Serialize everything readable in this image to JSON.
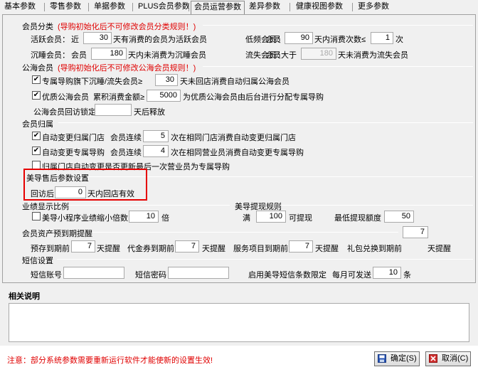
{
  "tabs": [
    "基本参数",
    "零售参数",
    "单据参数",
    "PLUS会员参数",
    "会员运营参数",
    "差异参数",
    "健康视图参数",
    "更多参数"
  ],
  "active_tab": "会员运营参数",
  "member_class": {
    "title": "会员分类",
    "warning": "(导购初始化后不可修改会员分类规则！)",
    "active_label": "活跃会员：",
    "active_pre": "近",
    "active_value": "30",
    "active_suffix": "天有消费的会员为活跃会员",
    "low_label": "低频会员：",
    "low_pre": "会员",
    "low_value": "90",
    "low_mid": "天内消费次数≤",
    "low_count": "1",
    "low_suffix": "次",
    "sleep_label": "沉睡会员：",
    "sleep_pre": "会员",
    "sleep_value": "180",
    "sleep_suffix": "天内未消费为沉睡会员",
    "lost_label": "流失会员：",
    "lost_pre": "会员大于",
    "lost_value": "180",
    "lost_suffix": "天未消费为流失会员"
  },
  "public_member": {
    "title": "公海会员",
    "warning": "(导购初始化后不可修改公海会员规则！)",
    "opt1_label": "专属导购旗下沉睡/流失会员≥",
    "opt1_value": "30",
    "opt1_suffix": "天未回店消费自动归属公海会员",
    "opt2_label": "优质公海会员",
    "opt2_mid": "累积消费金额≥",
    "opt2_value": "5000",
    "opt2_suffix": "为优质公海会员由后台进行分配专属导购",
    "lock_label": "公海会员回访锁定",
    "lock_value": "",
    "lock_suffix": "天后释放"
  },
  "member_belong": {
    "title": "会员归属",
    "opt1_label": "自动变更归属门店",
    "opt1_mid": "会员连续",
    "opt1_value": "5",
    "opt1_suffix": "次在相同门店消费自动变更归属门店",
    "opt2_label": "自动变更专属导购",
    "opt2_mid": "会员连续",
    "opt2_value": "4",
    "opt2_suffix": "次在相同营业员消费自动变更专属导购",
    "opt3_label": "归属门店自动变更是否更新最后一次营业员为专属导购"
  },
  "after_sale": {
    "title": "美导售后参数设置",
    "pre": "回访后",
    "value": "0",
    "suffix": "天内回店有效"
  },
  "performance": {
    "title": "业绩显示比例",
    "opt_label": "美导小程序业绩缩小倍数",
    "opt_value": "10",
    "opt_suffix": "倍"
  },
  "withdraw": {
    "title": "美导提现规则",
    "full_label": "满",
    "full_value": "100",
    "full_suffix": "可提现",
    "min_label": "最低提现额度",
    "min_value": "50"
  },
  "assets": {
    "title": "会员资产预到期提醒",
    "top_value": "7",
    "stock_label": "预存到期前",
    "stock_value": "7",
    "stock_suffix": "天提醒",
    "coupon_label": "代金券到期前",
    "coupon_value": "7",
    "coupon_suffix": "天提醒",
    "service_label": "服务项目到期前",
    "service_value": "7",
    "service_suffix": "天提醒",
    "gift_label": "礼包兑换到期前",
    "gift_suffix": "天提醒"
  },
  "sms": {
    "title": "短信设置",
    "account_label": "短信账号",
    "account_value": "",
    "password_label": "短信密码",
    "password_value": "",
    "limit_label": "启用美导短信条数限定",
    "monthly_label": "每月可发送",
    "monthly_value": "10",
    "monthly_suffix": "条"
  },
  "description": {
    "title": "相关说明",
    "text": ""
  },
  "footer": {
    "notice": "注意：部分系统参数需要重新运行软件才能使新的设置生效!",
    "ok_label": "确定(S)",
    "cancel_label": "取消(C)"
  },
  "colors": {
    "warning": "#e00000",
    "highlight_box": "#e60000"
  }
}
